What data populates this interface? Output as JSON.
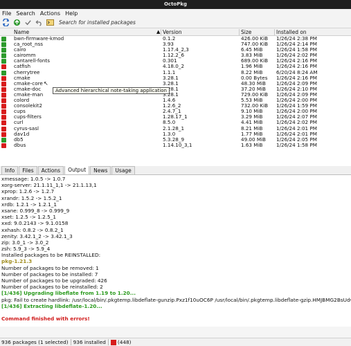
{
  "window": {
    "title": "OctoPkg"
  },
  "menu": [
    "File",
    "Search",
    "Actions",
    "Help"
  ],
  "toolbar": {
    "search_placeholder": "Search for installed packages"
  },
  "columns": {
    "name": "Name",
    "version": "Version",
    "size": "Size",
    "installed": "Installed on"
  },
  "packages": [
    {
      "status": "green",
      "name": "bwn-firmware-kmod",
      "version": "0.1.2",
      "size": "426.00 KiB",
      "installed": "1/26/24 2:38 PM"
    },
    {
      "status": "green",
      "name": "ca_root_nss",
      "version": "3.93",
      "size": "747.00 KiB",
      "installed": "1/26/24 2:14 PM"
    },
    {
      "status": "green",
      "name": "cairo",
      "version": "1.17.4_2,3",
      "size": "6.45 MiB",
      "installed": "1/26/24 1:58 PM"
    },
    {
      "status": "green",
      "name": "cairomm",
      "version": "1.12.2_6",
      "size": "3.83 MiB",
      "installed": "1/26/24 2:02 PM"
    },
    {
      "status": "green",
      "name": "cantarell-fonts",
      "version": "0.301",
      "size": "689.00 KiB",
      "installed": "1/26/24 2:16 PM"
    },
    {
      "status": "red",
      "name": "catfish",
      "version": "4.18.0_2",
      "size": "1.96 MiB",
      "installed": "1/26/24 2:16 PM"
    },
    {
      "status": "green",
      "name": "cherrytree",
      "version": "1.1.1",
      "size": "8.22 MiB",
      "installed": "6/20/24 8:24 AM"
    },
    {
      "status": "red",
      "name": "cmake",
      "version": "3.28.1",
      "size": "0.00 Bytes",
      "installed": "1/26/24 2:16 PM"
    },
    {
      "status": "red",
      "name": "cmake-core",
      "version": "3.28.1",
      "size": "48.30 MiB",
      "installed": "1/26/24 2:09 PM"
    },
    {
      "status": "red",
      "name": "cmake-doc",
      "version": "3.28.1",
      "size": "37.20 MiB",
      "installed": "1/26/24 2:10 PM"
    },
    {
      "status": "red",
      "name": "cmake-man",
      "version": "3.28.1",
      "size": "729.00 KiB",
      "installed": "1/26/24 2:09 PM"
    },
    {
      "status": "red",
      "name": "colord",
      "version": "1.4.6",
      "size": "5.53 MiB",
      "installed": "1/26/24 2:00 PM"
    },
    {
      "status": "red",
      "name": "consolekit2",
      "version": "1.2.6_2",
      "size": "732.00 KiB",
      "installed": "1/26/24 1:59 PM"
    },
    {
      "status": "red",
      "name": "cups",
      "version": "2.4.7_1",
      "size": "9.10 MiB",
      "installed": "1/26/24 2:00 PM"
    },
    {
      "status": "red",
      "name": "cups-filters",
      "version": "1.28.17_1",
      "size": "3.29 MiB",
      "installed": "1/26/24 2:07 PM"
    },
    {
      "status": "red",
      "name": "curl",
      "version": "8.5.0",
      "size": "4.41 MiB",
      "installed": "1/26/24 2:02 PM"
    },
    {
      "status": "red",
      "name": "cyrus-sasl",
      "version": "2.1.28_1",
      "size": "8.21 MiB",
      "installed": "1/26/24 2:01 PM"
    },
    {
      "status": "red",
      "name": "dav1d",
      "version": "1.3.0",
      "size": "1.77 MiB",
      "installed": "1/26/24 2:01 PM"
    },
    {
      "status": "green",
      "name": "db5",
      "version": "5.3.28_9",
      "size": "49.00 MiB",
      "installed": "1/26/24 2:05 PM"
    },
    {
      "status": "red",
      "name": "dbus",
      "version": "1.14.10_3,1",
      "size": "1.63 MiB",
      "installed": "1/26/24 1:58 PM"
    }
  ],
  "tooltip": "Advanced hierarchical note-taking application",
  "tabs": [
    "Info",
    "Files",
    "Actions",
    "Output",
    "News",
    "Usage"
  ],
  "output_lines": [
    {
      "t": "xmessage: 1.0.5 -> 1.0.7",
      "c": ""
    },
    {
      "t": "xorg-server: 21.1.11_1,1 -> 21.1.13,1",
      "c": ""
    },
    {
      "t": "xprop: 1.2.6 -> 1.2.7",
      "c": ""
    },
    {
      "t": "xrandr: 1.5.2 -> 1.5.2_1",
      "c": ""
    },
    {
      "t": "xrdb: 1.2.1 -> 1.2.1_1",
      "c": ""
    },
    {
      "t": "xsane: 0.999_8 -> 0.999_9",
      "c": ""
    },
    {
      "t": "xset: 1.2.5 -> 1.2.5_1",
      "c": ""
    },
    {
      "t": "xxd: 9.0.2143 -> 9.1.0158",
      "c": ""
    },
    {
      "t": "xxhash: 0.8.2 -> 0.8.2_1",
      "c": ""
    },
    {
      "t": "zenity: 3.42.1_2 -> 3.42.1_3",
      "c": ""
    },
    {
      "t": "zip: 3.0_1 -> 3.0_2",
      "c": ""
    },
    {
      "t": "zsh: 5.9_3 -> 5.9_4",
      "c": ""
    },
    {
      "t": "Installed packages to be REINSTALLED:",
      "c": ""
    },
    {
      "t": "pkg-1.21.3",
      "c": "pkg"
    },
    {
      "t": "Number of packages to be removed: 1",
      "c": ""
    },
    {
      "t": "Number of packages to be installed: 7",
      "c": ""
    },
    {
      "t": "Number of packages to be upgraded: 426",
      "c": ""
    },
    {
      "t": "Number of packages to be reinstalled: 2",
      "c": ""
    },
    {
      "t": "[1/436] Upgrading libeflate from 1.19 to 1.20...",
      "c": "ok"
    },
    {
      "t": "pkg: Fail to create hardlink: /usr/local/bin/.pkgtemp.libdeflate-gunzip.Pxz1f10uOC6P /usr/local/bin/.pkgtemp.libdeflate-gzip.HMJBMG2BsUdw:File exists",
      "c": ""
    },
    {
      "t": "[1/436] Extracting libdeflate-1.20...",
      "c": "ok"
    },
    {
      "t": "",
      "c": ""
    },
    {
      "t": "Command finished with errors!",
      "c": "err"
    }
  ],
  "status": {
    "packages": "936 packages (1 selected)",
    "installed": "936 installed",
    "outdated": "(448)"
  }
}
